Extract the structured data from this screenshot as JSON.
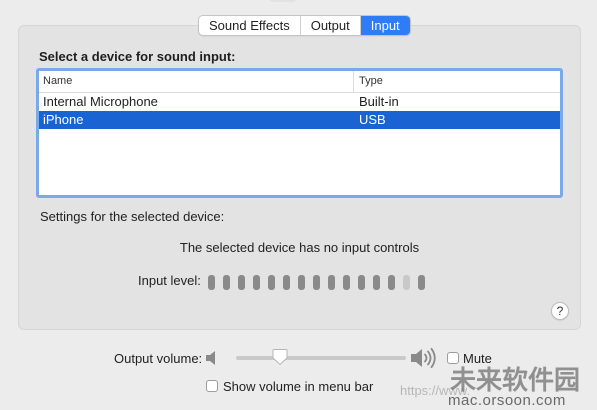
{
  "tabs": [
    {
      "label": "Sound Effects",
      "selected": false
    },
    {
      "label": "Output",
      "selected": false
    },
    {
      "label": "Input",
      "selected": true
    }
  ],
  "input": {
    "section_title": "Select a device for sound input:",
    "table": {
      "columns": [
        "Name",
        "Type"
      ],
      "rows": [
        {
          "name": "Internal Microphone",
          "type": "Built-in",
          "selected": false
        },
        {
          "name": "iPhone",
          "type": "USB",
          "selected": true
        }
      ]
    },
    "settings_label": "Settings for the selected device:",
    "no_controls_message": "The selected device has no input controls",
    "input_level_label": "Input level:",
    "input_level": {
      "segments_total": 15,
      "segments_lit": 13
    },
    "help_label": "?"
  },
  "footer": {
    "output_volume_label": "Output volume:",
    "output_volume_fraction": 0.25,
    "mute_label": "Mute",
    "mute_checked": false,
    "show_volume_label": "Show volume in menu bar",
    "show_volume_checked": false
  },
  "watermark": {
    "url_faint": "https://www.",
    "url": "mac.orsoon.com",
    "brand_cn": "未来软件园"
  },
  "colors": {
    "accent": "#2e7cf6",
    "selection": "#1a63d2",
    "focus_ring": "#7aa9e8",
    "panel": "#e3e3e3",
    "window": "#ececec"
  }
}
